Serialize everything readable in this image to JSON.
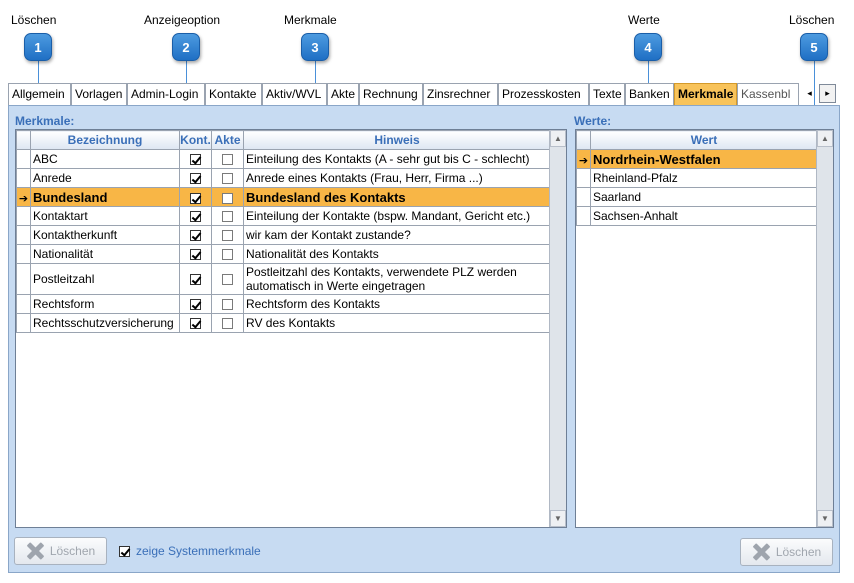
{
  "callouts": [
    {
      "num": "1",
      "label": "Löschen"
    },
    {
      "num": "2",
      "label": "Anzeigeoption"
    },
    {
      "num": "3",
      "label": "Merkmale"
    },
    {
      "num": "4",
      "label": "Werte"
    },
    {
      "num": "5",
      "label": "Löschen"
    }
  ],
  "tabs": [
    "Allgemein",
    "Vorlagen",
    "Admin-Login",
    "Kontakte",
    "Aktiv/WVL",
    "Akte",
    "Rechnung",
    "Zinsrechner",
    "Prozesskosten",
    "Texte",
    "Banken",
    "Merkmale",
    "Kassenbl"
  ],
  "active_tab": "Merkmale",
  "merkmale": {
    "label": "Merkmale:",
    "columns": {
      "bez": "Bezeichnung",
      "kont": "Kont.",
      "akte": "Akte",
      "hinweis": "Hinweis"
    },
    "rows": [
      {
        "bez": "ABC",
        "hinweis": "Einteilung des Kontakts (A - sehr gut bis C - schlecht)"
      },
      {
        "bez": "Anrede",
        "hinweis": "Anrede eines Kontakts (Frau, Herr, Firma ...)"
      },
      {
        "bez": "Bundesland",
        "hinweis": "Bundesland des Kontakts"
      },
      {
        "bez": "Kontaktart",
        "hinweis": "Einteilung der Kontakte (bspw. Mandant, Gericht etc.)"
      },
      {
        "bez": "Kontaktherkunft",
        "hinweis": "wir kam der Kontakt zustande?"
      },
      {
        "bez": "Nationalität",
        "hinweis": "Nationalität des Kontakts"
      },
      {
        "bez": "Postleitzahl",
        "hinweis": "Postleitzahl des Kontakts, verwendete PLZ werden automatisch in Werte eingetragen"
      },
      {
        "bez": "Rechtsform",
        "hinweis": "Rechtsform des Kontakts"
      },
      {
        "bez": "Rechtsschutzversicherung",
        "hinweis": "RV des Kontakts"
      }
    ]
  },
  "werte": {
    "label": "Werte:",
    "column": "Wert",
    "rows": [
      "Nordrhein-Westfalen",
      "Rheinland-Pfalz",
      "Saarland",
      "Sachsen-Anhalt"
    ]
  },
  "buttons": {
    "delete_left": "Löschen",
    "delete_right": "Löschen"
  },
  "system_checkbox_label": "zeige Systemmerkmale",
  "colors": {
    "accent": "#3a6fb8",
    "selected_row": "#f8b646",
    "panel_bg": "#c7dbf2"
  }
}
